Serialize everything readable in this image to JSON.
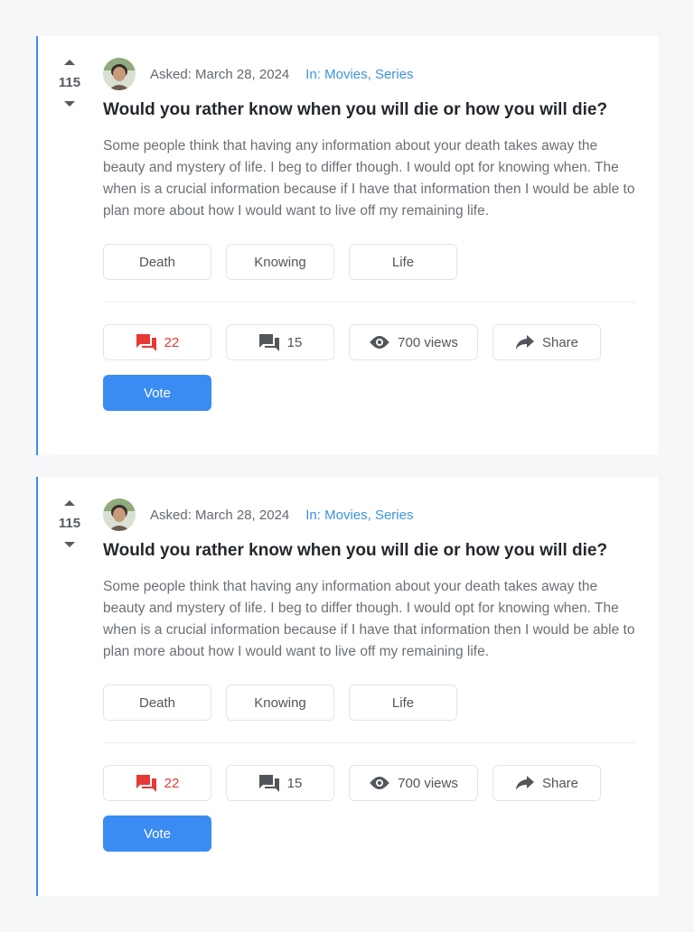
{
  "colors": {
    "accent": "#3b8cf2",
    "danger": "#e53935",
    "link": "#3b93df"
  },
  "questions": [
    {
      "votes": "115",
      "asked": "Asked: March 28, 2024",
      "category": "In: Movies, Series",
      "title": "Would you rather know when you will die or how you will die?",
      "body": "Some people think that having any information about your death takes away the beauty and mystery of life. I beg to differ though. I would opt for knowing when. The when is a crucial information because if I have that information then I would be able to plan more about how I would want to live off my remaining life.",
      "tags": [
        "Death",
        "Knowing",
        "Life"
      ],
      "answers": "22",
      "comments": "15",
      "views": "700 views",
      "share": "Share",
      "vote_label": "Vote",
      "icons": {
        "upvote": "caret-up-icon",
        "downvote": "caret-down-icon",
        "answers": "forum-icon",
        "comments": "comment-icon",
        "views": "eye-icon",
        "share": "share-arrow-icon"
      }
    },
    {
      "votes": "115",
      "asked": "Asked: March 28, 2024",
      "category": "In: Movies, Series",
      "title": "Would you rather know when you will die or how you will die?",
      "body": "Some people think that having any information about your death takes away the beauty and mystery of life. I beg to differ though. I would opt for knowing when. The when is a crucial information because if I have that information then I would be able to plan more about how I would want to live off my remaining life.",
      "tags": [
        "Death",
        "Knowing",
        "Life"
      ],
      "answers": "22",
      "comments": "15",
      "views": "700 views",
      "share": "Share",
      "vote_label": "Vote",
      "icons": {
        "upvote": "caret-up-icon",
        "downvote": "caret-down-icon",
        "answers": "forum-icon",
        "comments": "comment-icon",
        "views": "eye-icon",
        "share": "share-arrow-icon"
      }
    }
  ]
}
